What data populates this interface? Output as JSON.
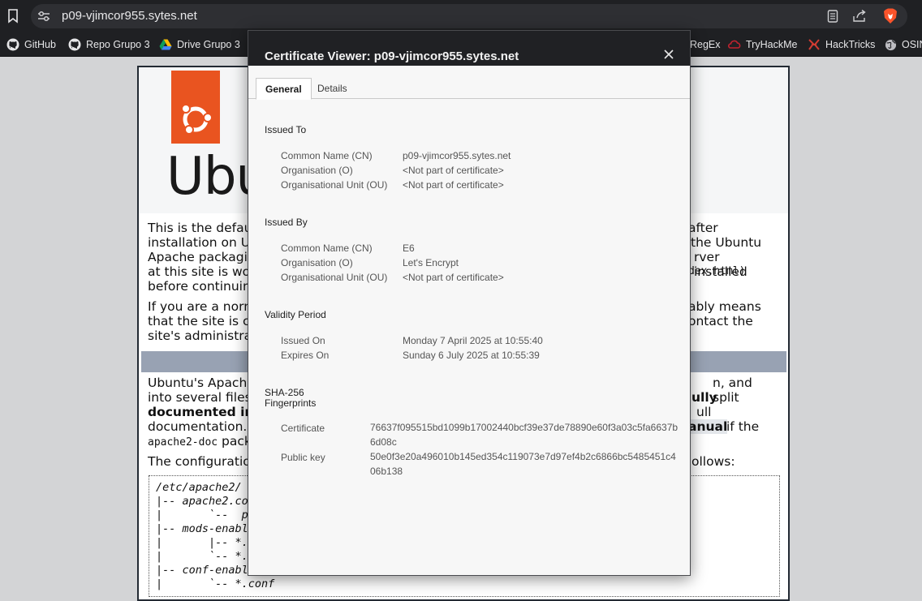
{
  "browser": {
    "url": "p09-vjimcor955.sytes.net",
    "bookmarks": [
      {
        "label": "GitHub",
        "icon": "github-icon"
      },
      {
        "label": "Repo Grupo 3",
        "icon": "github-icon"
      },
      {
        "label": "Drive Grupo 3",
        "icon": "google-drive-icon"
      },
      {
        "label": "RegEx",
        "icon": "bookmark-icon"
      },
      {
        "label": "TryHackMe",
        "icon": "tryhackme-icon"
      },
      {
        "label": "HackTricks",
        "icon": "hacktricks-icon"
      },
      {
        "label": "OSIN",
        "icon": "globe-icon"
      }
    ]
  },
  "page": {
    "logo_word": "Ubu",
    "p1": [
      "This is the defau",
      "after",
      "installation on Ub",
      "the Ubuntu",
      "Apache packagin",
      "rver installed",
      "at this site is wor",
      "dex.html)",
      "before continuing"
    ],
    "p2": [
      "If you are a norm",
      "ably means",
      "that the site is cu",
      "ontact the",
      "site's administrat"
    ],
    "p3": [
      "Ubuntu's Apache",
      "n, and split",
      "into several files",
      "ully",
      "documented in",
      "ull",
      "documentation. I",
      "anual",
      "if the",
      "apache2-doc",
      "pack"
    ],
    "p4": [
      "The configuratio",
      "ollows:"
    ],
    "code": [
      "/etc/apache2/",
      "|-- apache2.co",
      "|       `--  po",
      "|-- mods-enabl",
      "|       |-- *.",
      "|       `-- *.",
      "|-- conf-enabl",
      "|       `-- *.conf"
    ]
  },
  "dialog": {
    "title": "Certificate Viewer: p09-vjimcor955.sytes.net",
    "tabs": [
      "General",
      "Details"
    ],
    "issued_to": {
      "heading": "Issued To",
      "rows": [
        {
          "label": "Common Name (CN)",
          "value": "p09-vjimcor955.sytes.net"
        },
        {
          "label": "Organisation (O)",
          "value": "<Not part of certificate>"
        },
        {
          "label": "Organisational Unit (OU)",
          "value": "<Not part of certificate>"
        }
      ]
    },
    "issued_by": {
      "heading": "Issued By",
      "rows": [
        {
          "label": "Common Name (CN)",
          "value": "E6"
        },
        {
          "label": "Organisation (O)",
          "value": "Let's Encrypt"
        },
        {
          "label": "Organisational Unit (OU)",
          "value": "<Not part of certificate>"
        }
      ]
    },
    "validity": {
      "heading": "Validity Period",
      "rows": [
        {
          "label": "Issued On",
          "value": "Monday 7 April 2025 at 10:55:40"
        },
        {
          "label": "Expires On",
          "value": "Sunday 6 July 2025 at 10:55:39"
        }
      ]
    },
    "fingerprints": {
      "heading_line1": "SHA-256",
      "heading_line2": "Fingerprints",
      "rows": [
        {
          "label": "Certificate",
          "value": "76637f095515bd1099b17002440bcf39e37de78890e60f3a03c5fa6637b6d08c"
        },
        {
          "label": "Public key",
          "value": "50e0f3e20a496010b145ed354c119073e7d97ef4b2c6866bc5485451c406b138"
        }
      ]
    }
  },
  "colors": {
    "ubuntu_orange": "#e95420",
    "brave_orange": "#fb542b",
    "separator": "#98a2b3"
  }
}
